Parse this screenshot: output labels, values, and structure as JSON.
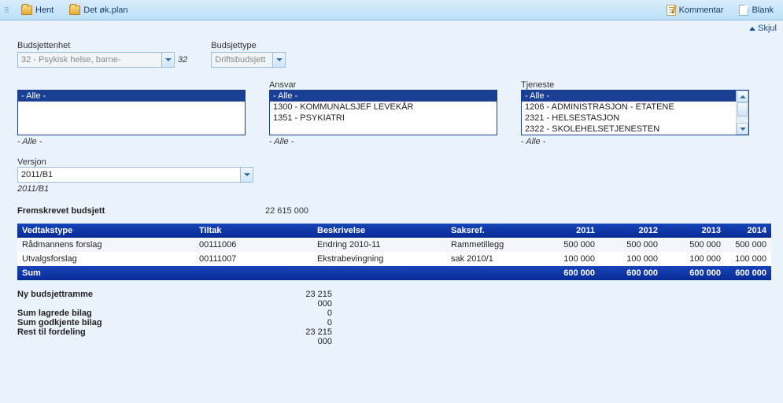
{
  "toolbar": {
    "hent": "Hent",
    "detokplan": "Det øk.plan",
    "kommentar": "Kommentar",
    "blank": "Blank"
  },
  "hide_link": "Skjul",
  "filters": {
    "budsjettenhet": {
      "label": "Budsjettenhet",
      "value": "32 - Psykisk helse, barne-",
      "side_note": "32"
    },
    "budsjettype": {
      "label": "Budsjettype",
      "value": "Driftsbudsjett"
    },
    "kolonne1": {
      "selected": "- Alle -",
      "below_note": "- Alle -"
    },
    "ansvar": {
      "label": "Ansvar",
      "items": [
        "- Alle -",
        "1300 - KOMMUNALSJEF LEVEKÅR",
        "1351 - PSYKIATRI"
      ],
      "selected_index": 0,
      "below_note": "- Alle -"
    },
    "tjeneste": {
      "label": "Tjeneste",
      "items": [
        "- Alle -",
        "1206 - ADMINISTRASJON - ETATENE",
        "2321 - HELSESTASJON",
        "2322 - SKOLEHELSETJENESTEN"
      ],
      "selected_index": 0,
      "below_note": "- Alle -"
    },
    "versjon": {
      "label": "Versjon",
      "value": "2011/B1",
      "below_note": "2011/B1"
    }
  },
  "fremskrevet": {
    "label": "Fremskrevet budsjett",
    "value": "22 615 000"
  },
  "grid": {
    "headers": [
      "Vedtakstype",
      "Tiltak",
      "Beskrivelse",
      "Saksref.",
      "2011",
      "2012",
      "2013",
      "2014"
    ],
    "rows": [
      {
        "vedtakstype": "Rådmannens forslag",
        "tiltak": "00111006",
        "beskrivelse": "Endring 2010-11",
        "saksref": "Rammetillegg",
        "y2011": "500 000",
        "y2012": "500 000",
        "y2013": "500 000",
        "y2014": "500 000"
      },
      {
        "vedtakstype": "Utvalgsforslag",
        "tiltak": "00111007",
        "beskrivelse": "Ekstrabevingning",
        "saksref": "sak 2010/1",
        "y2011": "100 000",
        "y2012": "100 000",
        "y2013": "100 000",
        "y2014": "100 000"
      }
    ],
    "sum": {
      "label": "Sum",
      "y2011": "600 000",
      "y2012": "600 000",
      "y2013": "600 000",
      "y2014": "600 000"
    }
  },
  "totals": {
    "ny_ramme": {
      "label": "Ny budsjettramme",
      "value": "23 215 000"
    },
    "lagrede": {
      "label": "Sum lagrede bilag",
      "value": "0"
    },
    "godkjente": {
      "label": "Sum godkjente bilag",
      "value": "0"
    },
    "rest": {
      "label": "Rest til fordeling",
      "value": "23 215 000"
    }
  }
}
